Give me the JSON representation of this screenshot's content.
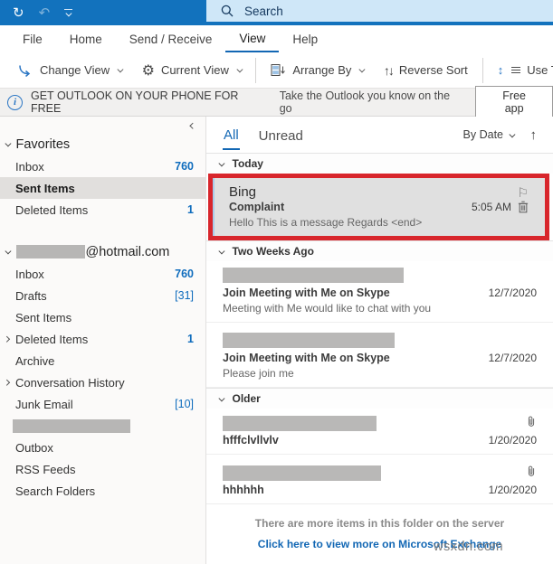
{
  "titlebar": {
    "search_label": "Search"
  },
  "menu": {
    "items": [
      "File",
      "Home",
      "Send / Receive",
      "View",
      "Help"
    ],
    "active": "View"
  },
  "ribbon": {
    "change_view": "Change View",
    "current_view": "Current View",
    "arrange_by": "Arrange By",
    "reverse_sort": "Reverse Sort",
    "use_tighter": "Use Tighter"
  },
  "banner": {
    "headline": "GET OUTLOOK ON YOUR PHONE FOR FREE",
    "subtext": "Take the Outlook you know on the go",
    "button_label": "Free app"
  },
  "sidebar": {
    "favorites": {
      "header": "Favorites",
      "inbox": "Inbox",
      "inbox_count": "760",
      "sent": "Sent Items",
      "deleted": "Deleted Items",
      "deleted_count": "1"
    },
    "account": {
      "domain": "@hotmail.com",
      "inbox": "Inbox",
      "inbox_count": "760",
      "drafts": "Drafts",
      "drafts_count": "[31]",
      "sent": "Sent Items",
      "deleted": "Deleted Items",
      "deleted_count": "1",
      "archive": "Archive",
      "conversation": "Conversation History",
      "junk": "Junk Email",
      "junk_count": "[10]",
      "outbox": "Outbox",
      "rss": "RSS Feeds",
      "search_folders": "Search Folders"
    }
  },
  "list": {
    "tab_all": "All",
    "tab_unread": "Unread",
    "sort_label": "By Date",
    "groups": {
      "today": "Today",
      "two_weeks": "Two Weeks Ago",
      "older": "Older"
    },
    "emails": {
      "bing": {
        "sender": "Bing",
        "subject": "Complaint",
        "preview": "Hello  This is a message  Regards <end>",
        "time": "5:05 AM"
      },
      "skype1": {
        "subject": "Join Meeting with Me on Skype",
        "preview": "Meeting with Me would like to chat with you",
        "date": "12/7/2020"
      },
      "skype2": {
        "subject": "Join Meeting with Me on Skype",
        "preview": "Please join me",
        "date": "12/7/2020"
      },
      "older1": {
        "subject": "hfffclvllvlv",
        "date": "1/20/2020"
      },
      "older2": {
        "subject": "hhhhhh",
        "date": "1/20/2020"
      }
    },
    "footer": {
      "message": "There are more items in this folder on the server",
      "link": "Click here to view more on Microsoft Exchange"
    }
  },
  "watermark": "wsxdn.com",
  "icons": {
    "sync": "↻",
    "undo": "↶",
    "gear": "⚙",
    "sort_arrows": "↑↓",
    "up_arrow": "↑",
    "updown": "↕",
    "flag": "⚐"
  },
  "colors": {
    "titlebar": "#1272bd",
    "accent": "#1267b4",
    "annotation": "#d8262c",
    "count": "#0f6cbd",
    "search_bg": "#cfe7f8"
  }
}
